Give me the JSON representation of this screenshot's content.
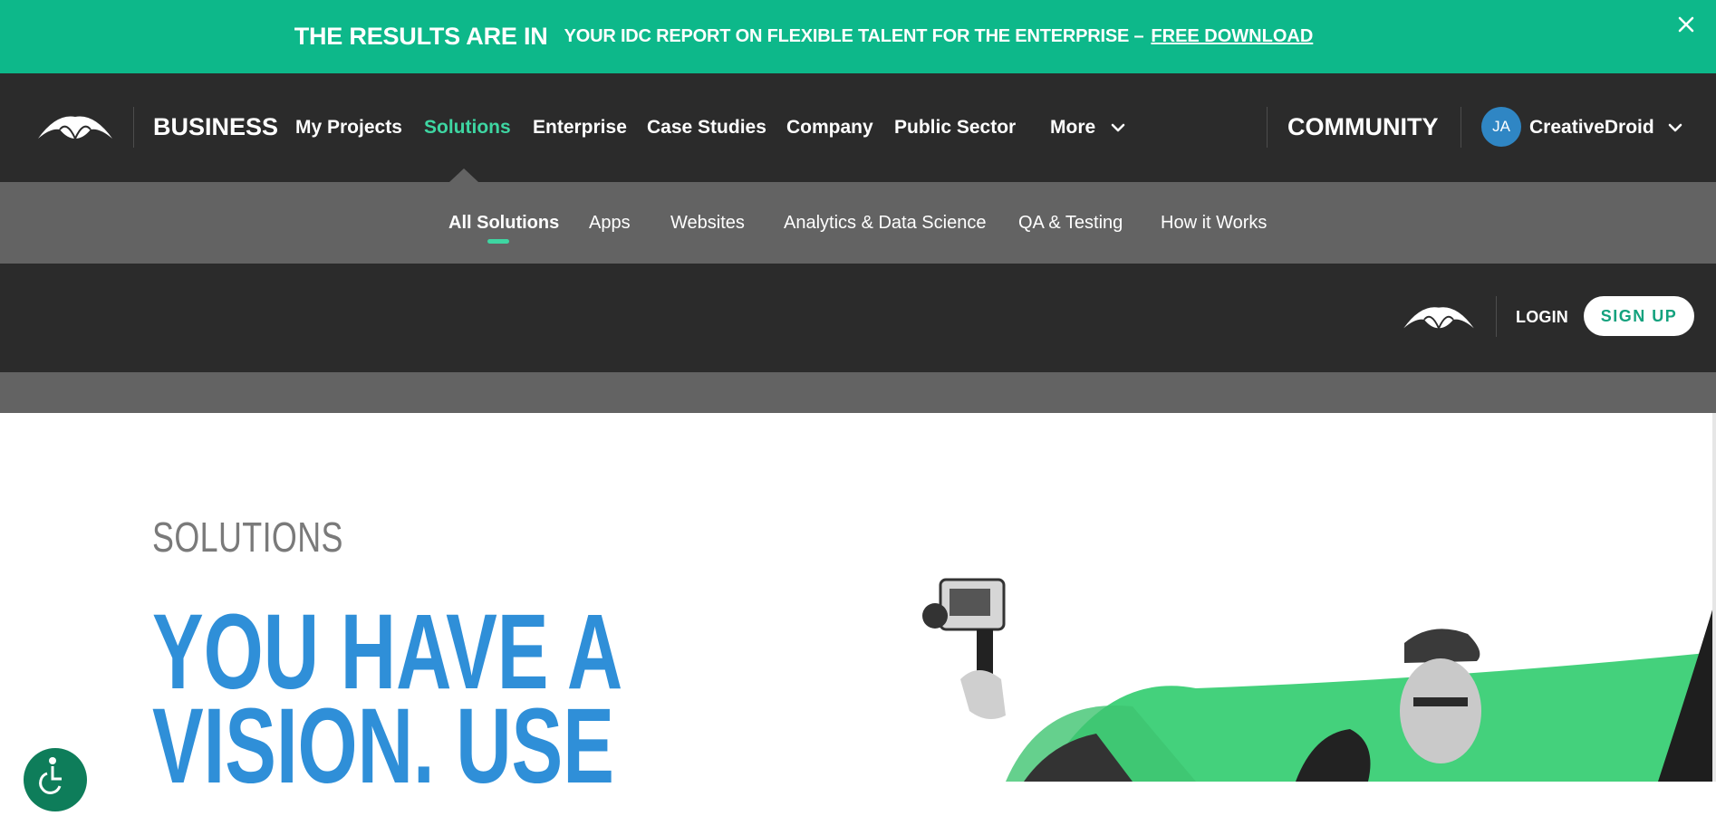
{
  "promo": {
    "headline": "THE RESULTS ARE IN",
    "text": "YOUR IDC REPORT ON FLEXIBLE TALENT FOR THE ENTERPRISE –",
    "link": "FREE DOWNLOAD",
    "close_icon": "close-icon"
  },
  "mainnav": {
    "brand": "BUSINESS",
    "links": [
      "My Projects",
      "Solutions",
      "Enterprise",
      "Case Studies",
      "Company",
      "Public Sector",
      "More"
    ],
    "community": "COMMUNITY",
    "user": {
      "initials": "JA",
      "name": "CreativeDroid"
    },
    "colors": {
      "bg": "#2b2b2b",
      "accent": "#3ed6a2"
    }
  },
  "subnav": {
    "links": [
      "All Solutions",
      "Apps",
      "Websites",
      "Analytics & Data Science",
      "QA & Testing",
      "How it Works"
    ]
  },
  "account": {
    "login": "LOGIN",
    "signup": "SIGN UP"
  },
  "hero": {
    "eyebrow": "SOLUTIONS",
    "title_line1": "YOU HAVE A",
    "title_line2": "VISION. USE",
    "title_color": "#2f8fd8"
  },
  "colors": {
    "promo_bg": "#0db88a",
    "subnav_bg": "#636363",
    "signup_text": "#14a27e"
  }
}
